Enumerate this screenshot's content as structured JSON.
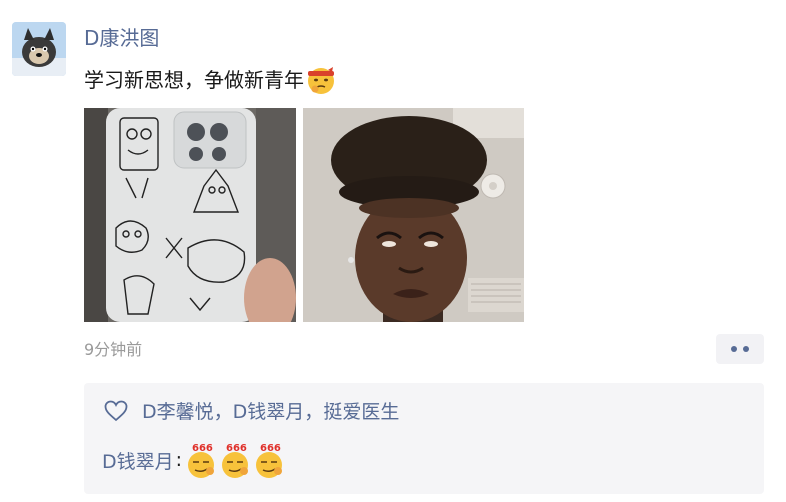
{
  "post": {
    "author": "D康洪图",
    "text": "学习新思想，争做新青年",
    "text_emoji": "thinking-emoji-with-headband",
    "time": "9分钟前",
    "images": [
      {
        "icon": "cartoon-drawn-phone-case-photo"
      },
      {
        "icon": "man-tall-hair-grimace-photo"
      }
    ]
  },
  "likes": {
    "icon": "heart-icon",
    "names": [
      "D李馨悦",
      "D钱翠月",
      "挺爱医生"
    ],
    "separator": "，"
  },
  "comments": [
    {
      "author": "D钱翠月",
      "colon": ":",
      "emojis": [
        {
          "name": "666-smirk-emoji",
          "label": "666"
        },
        {
          "name": "666-smirk-emoji",
          "label": "666"
        },
        {
          "name": "666-smirk-emoji",
          "label": "666"
        }
      ]
    }
  ],
  "colors": {
    "link": "#576b95",
    "text": "#191919",
    "muted": "#9a9a9a",
    "comment_bg": "#f5f5f7"
  }
}
